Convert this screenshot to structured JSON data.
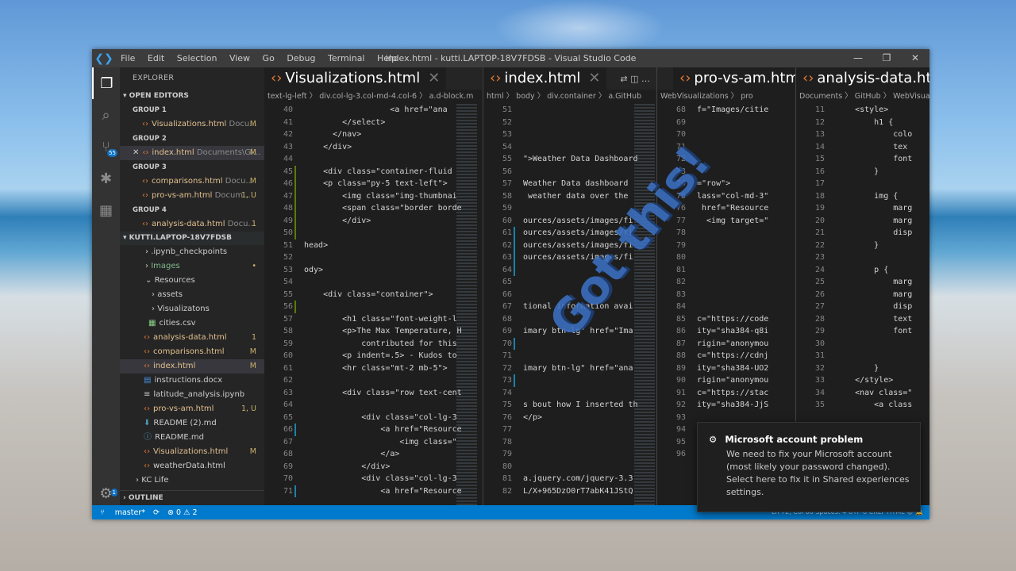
{
  "window": {
    "title": "index.html - kutti.LAPTOP-18V7FDSB - Visual Studio Code"
  },
  "menu": [
    "File",
    "Edit",
    "Selection",
    "View",
    "Go",
    "Debug",
    "Terminal",
    "Help"
  ],
  "activity": {
    "scm_badge": "55",
    "settings_badge": "1"
  },
  "sidebar": {
    "explorer_label": "EXPLORER",
    "open_editors_label": "OPEN EDITORS",
    "groups": [
      {
        "label": "GROUP 1",
        "files": [
          {
            "name": "Visualizations.html",
            "path": "Docu...",
            "status": "M"
          }
        ]
      },
      {
        "label": "GROUP 2",
        "files": [
          {
            "name": "index.html",
            "path": "Documents\\Gi...",
            "status": "M"
          }
        ]
      },
      {
        "label": "GROUP 3",
        "files": [
          {
            "name": "comparisons.html",
            "path": "Docu...",
            "status": "M"
          },
          {
            "name": "pro-vs-am.html",
            "path": "Docum...",
            "status": "1, U"
          }
        ]
      },
      {
        "label": "GROUP 4",
        "files": [
          {
            "name": "analysis-data.html",
            "path": "Docu...",
            "status": "1"
          }
        ]
      }
    ],
    "folder_label": "KUTTI.LAPTOP-18V7FDSB",
    "tree": [
      {
        "name": ".ipynb_checkpoints",
        "status": ""
      },
      {
        "name": "Images",
        "status": "•"
      },
      {
        "name": "Resources",
        "status": ""
      },
      {
        "name": "assets",
        "status": ""
      },
      {
        "name": "Visualizatons",
        "status": ""
      },
      {
        "name": "cities.csv",
        "status": ""
      },
      {
        "name": "analysis-data.html",
        "status": "1"
      },
      {
        "name": "comparisons.html",
        "status": "M"
      },
      {
        "name": "index.html",
        "status": "M"
      },
      {
        "name": "instructions.docx",
        "status": ""
      },
      {
        "name": "latitude_analysis.ipynb",
        "status": ""
      },
      {
        "name": "pro-vs-am.html",
        "status": "1, U"
      },
      {
        "name": "README (2).md",
        "status": ""
      },
      {
        "name": "README.md",
        "status": ""
      },
      {
        "name": "Visualizations.html",
        "status": "M"
      },
      {
        "name": "weatherData.html",
        "status": ""
      },
      {
        "name": "KC Life",
        "status": ""
      }
    ],
    "outline_label": "OUTLINE"
  },
  "panes": [
    {
      "tab": "Visualizations.html",
      "crumb": "text-lg-left  〉 div.col-lg-3.col-md-4.col-6  〉 a.d-block.m",
      "lines": [
        [
          "40",
          "                  <a href=\"ana"
        ],
        [
          "41",
          "        </select>"
        ],
        [
          "42",
          "      </nav>"
        ],
        [
          "43",
          "    </div>"
        ],
        [
          "44",
          ""
        ],
        [
          "45",
          "    <div class=\"container-fluid"
        ],
        [
          "46",
          "    <p class=\"py-5 text-left\">"
        ],
        [
          "47",
          "        <img class=\"img-thumbnai"
        ],
        [
          "48",
          "        <span class=\"border borde"
        ],
        [
          "49",
          "        </div>"
        ],
        [
          "50",
          ""
        ],
        [
          "51",
          "head>"
        ],
        [
          "52",
          ""
        ],
        [
          "53",
          "ody>"
        ],
        [
          "54",
          ""
        ],
        [
          "55",
          "    <div class=\"container\">"
        ],
        [
          "56",
          ""
        ],
        [
          "57",
          "        <h1 class=\"font-weight-l"
        ],
        [
          "58",
          "        <p>The Max Temperature, H"
        ],
        [
          "59",
          "            contributed for this"
        ],
        [
          "60",
          "        <p indent=.5> - Kudos to"
        ],
        [
          "61",
          "        <hr class=\"mt-2 mb-5\">"
        ],
        [
          "62",
          ""
        ],
        [
          "63",
          "        <div class=\"row text-cent"
        ],
        [
          "64",
          ""
        ],
        [
          "65",
          "            <div class=\"col-lg-3"
        ],
        [
          "66",
          "                <a href=\"Resource"
        ],
        [
          "67",
          "                    <img class=\""
        ],
        [
          "68",
          "                </a>"
        ],
        [
          "69",
          "            </div>"
        ],
        [
          "70",
          "            <div class=\"col-lg-3"
        ],
        [
          "71",
          "                <a href=\"Resource"
        ]
      ]
    },
    {
      "tab": "index.html",
      "crumb": "html 〉 body 〉 div.container 〉 a.GitHub",
      "lines": [
        [
          "51",
          ""
        ],
        [
          "52",
          ""
        ],
        [
          "53",
          ""
        ],
        [
          "54",
          ""
        ],
        [
          "55",
          "\">Weather Data Dashboard"
        ],
        [
          "56",
          ""
        ],
        [
          "57",
          "Weather Data dashboard"
        ],
        [
          "58",
          " weather data over the"
        ],
        [
          "59",
          ""
        ],
        [
          "60",
          "ources/assets/images/fi"
        ],
        [
          "61",
          "ources/assets/images/fi"
        ],
        [
          "62",
          "ources/assets/images/fi"
        ],
        [
          "63",
          "ources/assets/images/fi"
        ],
        [
          "64",
          ""
        ],
        [
          "65",
          ""
        ],
        [
          "66",
          ""
        ],
        [
          "67",
          "tional information avai"
        ],
        [
          "68",
          ""
        ],
        [
          "69",
          "imary btn-lg\" href=\"Ima"
        ],
        [
          "70",
          ""
        ],
        [
          "71",
          ""
        ],
        [
          "72",
          "imary btn-lg\" href=\"ana"
        ],
        [
          "73",
          ""
        ],
        [
          "74",
          ""
        ],
        [
          "75",
          "s bout how I inserted th"
        ],
        [
          "76",
          "</p>"
        ],
        [
          "77",
          ""
        ],
        [
          "78",
          ""
        ],
        [
          "79",
          ""
        ],
        [
          "80",
          ""
        ],
        [
          "81",
          "a.jquery.com/jquery-3.3"
        ],
        [
          "82",
          "L/X+965DzO0rT7abK41JStQ"
        ]
      ]
    },
    {
      "tab": "pro-vs-am.html",
      "crumb": "WebVisualizations 〉 pro",
      "lines": [
        [
          "68",
          "f=\"Images/citie"
        ],
        [
          "69",
          ""
        ],
        [
          "70",
          ""
        ],
        [
          "71",
          ""
        ],
        [
          "72",
          ""
        ],
        [
          "73",
          ""
        ],
        [
          "74",
          "=\"row\">"
        ],
        [
          "75",
          "lass=\"col-md-3\""
        ],
        [
          "76",
          " href=\"Resource"
        ],
        [
          "77",
          "  <img target=\""
        ],
        [
          "78",
          ""
        ],
        [
          "79",
          ""
        ],
        [
          "80",
          ""
        ],
        [
          "81",
          ""
        ],
        [
          "82",
          ""
        ],
        [
          "83",
          ""
        ],
        [
          "84",
          ""
        ],
        [
          "85",
          "c=\"https://code"
        ],
        [
          "86",
          "ity=\"sha384-q8i"
        ],
        [
          "87",
          "rigin=\"anonymou"
        ],
        [
          "88",
          "c=\"https://cdnj"
        ],
        [
          "89",
          "ity=\"sha384-UO2"
        ],
        [
          "90",
          "rigin=\"anonymou"
        ],
        [
          "91",
          "c=\"https://stac"
        ],
        [
          "92",
          "ity=\"sha384-JjS"
        ],
        [
          "93",
          ""
        ],
        [
          "94",
          ""
        ],
        [
          "95",
          ""
        ],
        [
          "96",
          ""
        ]
      ]
    },
    {
      "tab": "analysis-data.html",
      "crumb": "Documents 〉 GitHub 〉 WebVisualiz",
      "lines": [
        [
          "11",
          "    <style>"
        ],
        [
          "12",
          "        h1 {"
        ],
        [
          "13",
          "            colo"
        ],
        [
          "14",
          "            tex"
        ],
        [
          "15",
          "            font"
        ],
        [
          "16",
          "        }"
        ],
        [
          "17",
          ""
        ],
        [
          "18",
          "        img {"
        ],
        [
          "19",
          "            marg"
        ],
        [
          "20",
          "            marg"
        ],
        [
          "21",
          "            disp"
        ],
        [
          "22",
          "        }"
        ],
        [
          "23",
          ""
        ],
        [
          "24",
          "        p {"
        ],
        [
          "25",
          "            marg"
        ],
        [
          "26",
          "            marg"
        ],
        [
          "27",
          "            disp"
        ],
        [
          "28",
          "            text"
        ],
        [
          "29",
          "            font"
        ],
        [
          "30",
          ""
        ],
        [
          "31",
          ""
        ],
        [
          "32",
          "        }"
        ],
        [
          "33",
          "    </style>"
        ],
        [
          "34",
          "    <nav class=\""
        ],
        [
          "35",
          "        <a class"
        ]
      ]
    }
  ],
  "status": {
    "branch": "master*",
    "sync": "⟳",
    "problems": "⊗ 0 ⚠ 2",
    "right": "Ln 72, Col 60   Spaces: 4   UTF-8   CRLF   HTML   ☺   🔔"
  },
  "toast": {
    "title": "Microsoft account problem",
    "body": "We need to fix your Microsoft account (most likely your password changed). Select here to fix it in Shared experiences settings."
  },
  "overlay_text": "Got this!"
}
